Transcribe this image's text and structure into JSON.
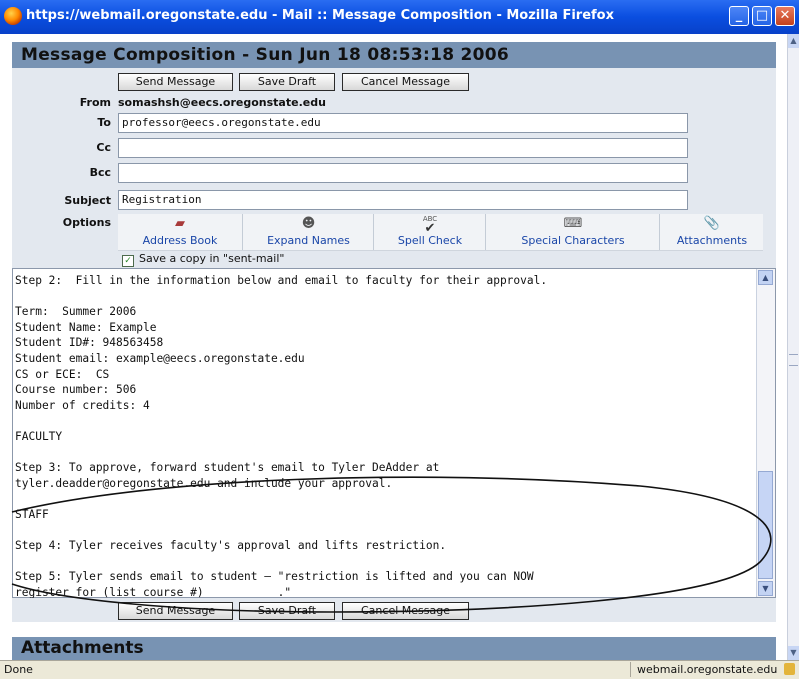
{
  "window": {
    "title": "https://webmail.oregonstate.edu - Mail :: Message Composition - Mozilla Firefox",
    "minimize": "_",
    "maximize": "□",
    "close": "✕"
  },
  "header": {
    "title": "Message Composition - Sun Jun 18 08:53:18 2006"
  },
  "toolbar": {
    "send": "Send Message",
    "save": "Save Draft",
    "cancel": "Cancel Message"
  },
  "form": {
    "from_label": "From",
    "from_value": "somashsh@eecs.oregonstate.edu",
    "to_label": "To",
    "to_value": "professor@eecs.oregonstate.edu",
    "cc_label": "Cc",
    "cc_value": "",
    "bcc_label": "Bcc",
    "bcc_value": "",
    "subject_label": "Subject",
    "subject_value": "Registration",
    "options_label": "Options"
  },
  "options": {
    "address_book": "Address Book",
    "expand_names": "Expand Names",
    "spell_check": "Spell Check",
    "special_characters": "Special Characters",
    "attachments": "Attachments",
    "spell_icon_text": "ABC",
    "save_copy": "Save a copy in \"sent-mail\""
  },
  "body": {
    "text": "Step 2:  Fill in the information below and email to faculty for their approval.\n\nTerm:  Summer 2006\nStudent Name: Example\nStudent ID#: 948563458\nStudent email: example@eecs.oregonstate.edu\nCS or ECE:  CS\nCourse number: 506\nNumber of credits: 4\n\nFACULTY\n\nStep 3: To approve, forward student's email to Tyler DeAdder at\ntyler.deadder@oregonstate.edu and include your approval.\n\nSTAFF\n\nStep 4: Tyler receives faculty's approval and lifts restriction.\n\nStep 5: Tyler sends email to student – \"restriction is lifted and you can NOW\nregister for (list course #)___________.\""
  },
  "attachments_section": {
    "title": "Attachments"
  },
  "status": {
    "left": "Done",
    "right": "webmail.oregonstate.edu"
  }
}
